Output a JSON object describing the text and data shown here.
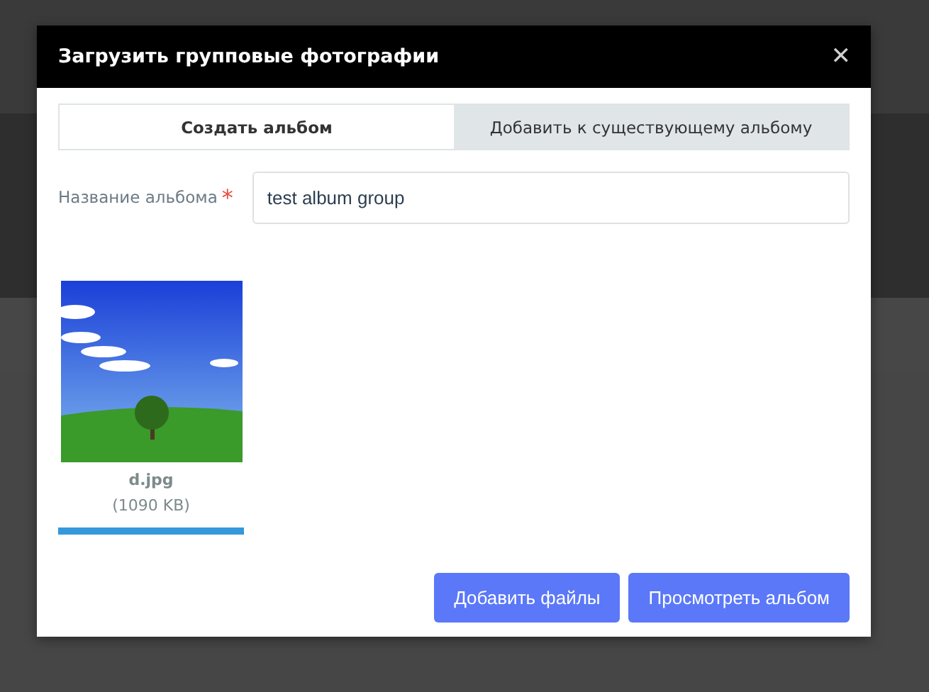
{
  "dialog": {
    "title": "Загрузить групповые фотографии",
    "close": "✕",
    "tabs": [
      {
        "label": "Создать альбом",
        "selected": true
      },
      {
        "label": "Добавить к существующему альбому",
        "selected": false
      }
    ],
    "album_name": {
      "label": "Название альбома",
      "required_mark": "*",
      "value": "test album group"
    },
    "files": [
      {
        "name": "d.jpg",
        "size": "(1090 KB)",
        "level": 1
      }
    ],
    "buttons": [
      {
        "label": "Добавить файлы"
      },
      {
        "label": "Просмотреть альбом"
      }
    ]
  }
}
